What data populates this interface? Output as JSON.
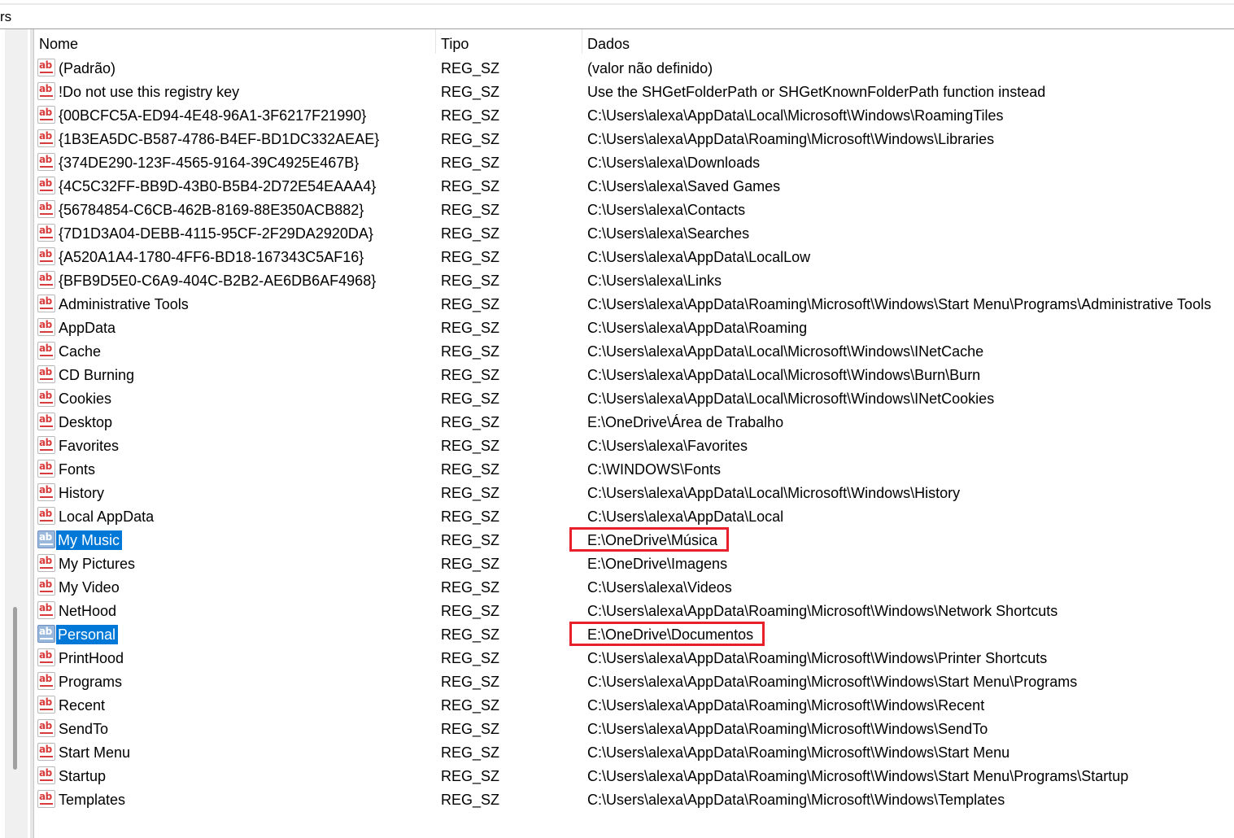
{
  "address_fragment": "rs",
  "columns": {
    "name": "Nome",
    "type": "Tipo",
    "data": "Dados"
  },
  "icon_name": "registry-string-icon",
  "icon_glyph": "ab",
  "colors": {
    "selection": "#0078d7",
    "highlight_box": "#e8202c",
    "icon_red": "#d83b3b"
  },
  "rows": [
    {
      "name": "(Padrão)",
      "type": "REG_SZ",
      "data": "(valor não definido)"
    },
    {
      "name": "!Do not use this registry key",
      "type": "REG_SZ",
      "data": "Use the SHGetFolderPath or SHGetKnownFolderPath function instead"
    },
    {
      "name": "{00BCFC5A-ED94-4E48-96A1-3F6217F21990}",
      "type": "REG_SZ",
      "data": "C:\\Users\\alexa\\AppData\\Local\\Microsoft\\Windows\\RoamingTiles"
    },
    {
      "name": "{1B3EA5DC-B587-4786-B4EF-BD1DC332AEAE}",
      "type": "REG_SZ",
      "data": "C:\\Users\\alexa\\AppData\\Roaming\\Microsoft\\Windows\\Libraries"
    },
    {
      "name": "{374DE290-123F-4565-9164-39C4925E467B}",
      "type": "REG_SZ",
      "data": "C:\\Users\\alexa\\Downloads"
    },
    {
      "name": "{4C5C32FF-BB9D-43B0-B5B4-2D72E54EAAA4}",
      "type": "REG_SZ",
      "data": "C:\\Users\\alexa\\Saved Games"
    },
    {
      "name": "{56784854-C6CB-462B-8169-88E350ACB882}",
      "type": "REG_SZ",
      "data": "C:\\Users\\alexa\\Contacts"
    },
    {
      "name": "{7D1D3A04-DEBB-4115-95CF-2F29DA2920DA}",
      "type": "REG_SZ",
      "data": "C:\\Users\\alexa\\Searches"
    },
    {
      "name": "{A520A1A4-1780-4FF6-BD18-167343C5AF16}",
      "type": "REG_SZ",
      "data": "C:\\Users\\alexa\\AppData\\LocalLow"
    },
    {
      "name": "{BFB9D5E0-C6A9-404C-B2B2-AE6DB6AF4968}",
      "type": "REG_SZ",
      "data": "C:\\Users\\alexa\\Links"
    },
    {
      "name": "Administrative Tools",
      "type": "REG_SZ",
      "data": "C:\\Users\\alexa\\AppData\\Roaming\\Microsoft\\Windows\\Start Menu\\Programs\\Administrative Tools"
    },
    {
      "name": "AppData",
      "type": "REG_SZ",
      "data": "C:\\Users\\alexa\\AppData\\Roaming"
    },
    {
      "name": "Cache",
      "type": "REG_SZ",
      "data": "C:\\Users\\alexa\\AppData\\Local\\Microsoft\\Windows\\INetCache"
    },
    {
      "name": "CD Burning",
      "type": "REG_SZ",
      "data": "C:\\Users\\alexa\\AppData\\Local\\Microsoft\\Windows\\Burn\\Burn"
    },
    {
      "name": "Cookies",
      "type": "REG_SZ",
      "data": "C:\\Users\\alexa\\AppData\\Local\\Microsoft\\Windows\\INetCookies"
    },
    {
      "name": "Desktop",
      "type": "REG_SZ",
      "data": "E:\\OneDrive\\Área de Trabalho"
    },
    {
      "name": "Favorites",
      "type": "REG_SZ",
      "data": "C:\\Users\\alexa\\Favorites"
    },
    {
      "name": "Fonts",
      "type": "REG_SZ",
      "data": "C:\\WINDOWS\\Fonts"
    },
    {
      "name": "History",
      "type": "REG_SZ",
      "data": "C:\\Users\\alexa\\AppData\\Local\\Microsoft\\Windows\\History"
    },
    {
      "name": "Local AppData",
      "type": "REG_SZ",
      "data": "C:\\Users\\alexa\\AppData\\Local"
    },
    {
      "name": "My Music",
      "type": "REG_SZ",
      "data": "E:\\OneDrive\\Música",
      "selected": true,
      "highlighted": true
    },
    {
      "name": "My Pictures",
      "type": "REG_SZ",
      "data": "E:\\OneDrive\\Imagens"
    },
    {
      "name": "My Video",
      "type": "REG_SZ",
      "data": "C:\\Users\\alexa\\Videos"
    },
    {
      "name": "NetHood",
      "type": "REG_SZ",
      "data": "C:\\Users\\alexa\\AppData\\Roaming\\Microsoft\\Windows\\Network Shortcuts"
    },
    {
      "name": "Personal",
      "type": "REG_SZ",
      "data": "E:\\OneDrive\\Documentos",
      "selected": true,
      "highlighted": true
    },
    {
      "name": "PrintHood",
      "type": "REG_SZ",
      "data": "C:\\Users\\alexa\\AppData\\Roaming\\Microsoft\\Windows\\Printer Shortcuts"
    },
    {
      "name": "Programs",
      "type": "REG_SZ",
      "data": "C:\\Users\\alexa\\AppData\\Roaming\\Microsoft\\Windows\\Start Menu\\Programs"
    },
    {
      "name": "Recent",
      "type": "REG_SZ",
      "data": "C:\\Users\\alexa\\AppData\\Roaming\\Microsoft\\Windows\\Recent"
    },
    {
      "name": "SendTo",
      "type": "REG_SZ",
      "data": "C:\\Users\\alexa\\AppData\\Roaming\\Microsoft\\Windows\\SendTo"
    },
    {
      "name": "Start Menu",
      "type": "REG_SZ",
      "data": "C:\\Users\\alexa\\AppData\\Roaming\\Microsoft\\Windows\\Start Menu"
    },
    {
      "name": "Startup",
      "type": "REG_SZ",
      "data": "C:\\Users\\alexa\\AppData\\Roaming\\Microsoft\\Windows\\Start Menu\\Programs\\Startup"
    },
    {
      "name": "Templates",
      "type": "REG_SZ",
      "data": "C:\\Users\\alexa\\AppData\\Roaming\\Microsoft\\Windows\\Templates"
    }
  ]
}
